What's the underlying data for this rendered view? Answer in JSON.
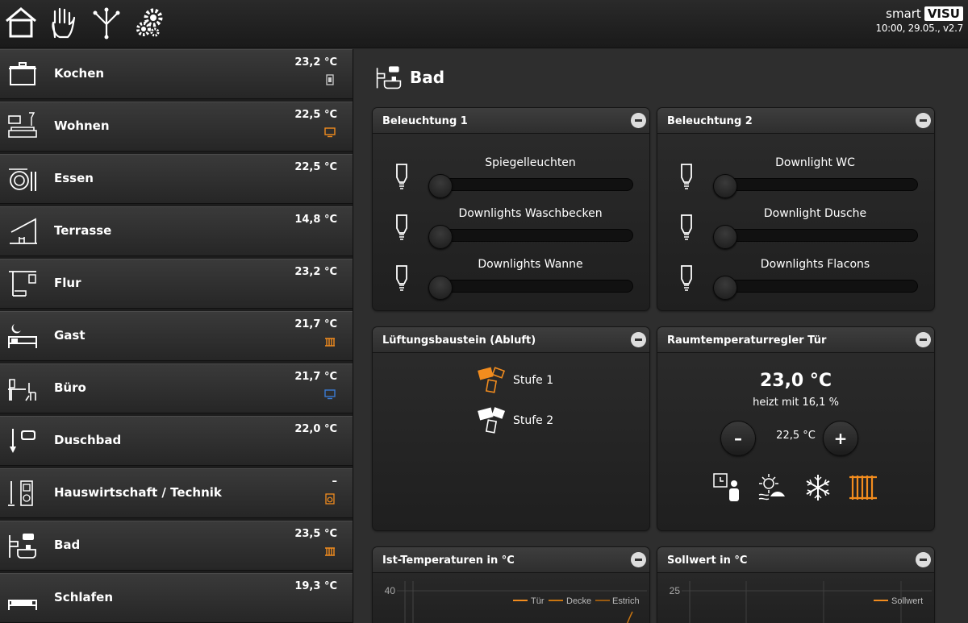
{
  "header": {
    "icons": [
      "home-icon",
      "hand-icon",
      "network-icon",
      "gears-icon"
    ],
    "brand_smart": "smart",
    "brand_visu": "VISU",
    "brand_sub": "10:00, 29.05., v2.7"
  },
  "rooms": [
    {
      "name": "Kochen",
      "temp": "23,2 °C",
      "icon": "pot-icon",
      "indicator": "window-contact-icon"
    },
    {
      "name": "Wohnen",
      "temp": "22,5 °C",
      "icon": "sofa-tv-icon",
      "indicator": "tv-icon"
    },
    {
      "name": "Essen",
      "temp": "22,5 °C",
      "icon": "plate-cutlery-icon",
      "indicator": ""
    },
    {
      "name": "Terrasse",
      "temp": "14,8 °C",
      "icon": "terrace-icon",
      "indicator": ""
    },
    {
      "name": "Flur",
      "temp": "23,2 °C",
      "icon": "hallway-icon",
      "indicator": ""
    },
    {
      "name": "Gast",
      "temp": "21,7 °C",
      "icon": "guest-bed-icon",
      "indicator": "radiator-icon"
    },
    {
      "name": "Büro",
      "temp": "21,7 °C",
      "icon": "desk-icon",
      "indicator": "monitor-icon"
    },
    {
      "name": "Duschbad",
      "temp": "22,0 °C",
      "icon": "shower-icon",
      "indicator": ""
    },
    {
      "name": "Hauswirtschaft / Technik",
      "temp": "–",
      "icon": "utility-icon",
      "indicator": "washer-icon"
    },
    {
      "name": "Bad",
      "temp": "23,5 °C",
      "icon": "bath-icon",
      "indicator": "radiator-icon"
    },
    {
      "name": "Schlafen",
      "temp": "19,3 °C",
      "icon": "bed-icon",
      "indicator": ""
    }
  ],
  "page": {
    "title": "Bad",
    "icon": "bath-icon"
  },
  "panels": {
    "light1": {
      "title": "Beleuchtung 1",
      "dimmers": [
        {
          "label": "Spiegelleuchten",
          "level": 0
        },
        {
          "label": "Downlights Waschbecken",
          "level": 0
        },
        {
          "label": "Downlights Wanne",
          "level": 0
        }
      ]
    },
    "light2": {
      "title": "Beleuchtung 2",
      "dimmers": [
        {
          "label": "Downlight WC",
          "level": 0
        },
        {
          "label": "Downlight Dusche",
          "level": 0
        },
        {
          "label": "Downlights Flacons",
          "level": 0
        }
      ]
    },
    "vent": {
      "title": "Lüftungsbaustein (Abluft)",
      "items": [
        {
          "label": "Stufe 1",
          "active": true
        },
        {
          "label": "Stufe 2",
          "active": false
        }
      ]
    },
    "rtr": {
      "title": "Raumtemperaturregler Tür",
      "actual": "23,0 °C",
      "info": "heizt mit 16,1 %",
      "minus": "–",
      "setpoint": "22,5 °C",
      "plus": "+",
      "modes": [
        "comfort-icon",
        "night-icon",
        "frost-icon",
        "heating-icon"
      ],
      "active_mode": "heating-icon"
    },
    "ist": {
      "title": "Ist-Temperaturen in °C"
    },
    "soll": {
      "title": "Sollwert in °C"
    }
  },
  "colors": {
    "accent": "#f28c1e",
    "bg": "#2e2e2e",
    "text": "#ffffff",
    "tv_blue": "#3a7bd5"
  },
  "chart_data": [
    {
      "type": "line",
      "title": "Ist-Temperaturen in °C",
      "y_tick_top": "40",
      "series": [
        {
          "name": "Tür"
        },
        {
          "name": "Decke"
        },
        {
          "name": "Estrich"
        }
      ],
      "legend": "top-right"
    },
    {
      "type": "line",
      "title": "Sollwert in °C",
      "y_tick_top": "25",
      "series": [
        {
          "name": "Sollwert"
        }
      ],
      "legend": "top-right"
    }
  ]
}
